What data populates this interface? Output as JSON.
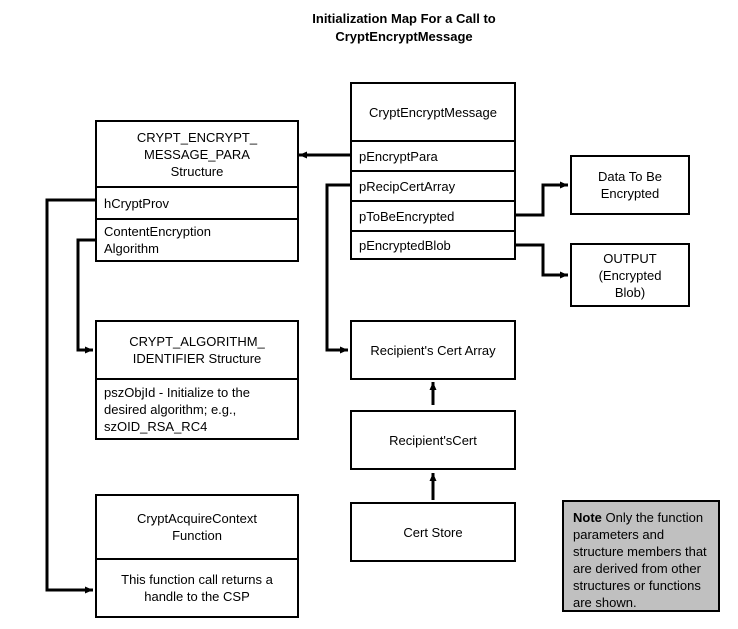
{
  "diagram": {
    "title_line1": "Initialization Map For a Call to",
    "title_line2": "CryptEncryptMessage",
    "colors": {
      "stroke": "#000000",
      "background": "#ffffff",
      "note_background": "#c0c0c0"
    }
  },
  "function_box": {
    "header": "CryptEncryptMessage",
    "params": [
      "pEncryptPara",
      "pRecipCertArray",
      "pToBeEncrypted",
      "pEncryptedBlob"
    ]
  },
  "encrypt_para_struct": {
    "header_line1": "CRYPT_ENCRYPT_",
    "header_line2": "MESSAGE_PARA",
    "header_line3": "Structure",
    "members": [
      "hCryptProv",
      "ContentEncryption\nAlgorithm"
    ],
    "member_1": "hCryptProv",
    "member_2_line1": "ContentEncryption",
    "member_2_line2": "Algorithm"
  },
  "algorithm_identifier_struct": {
    "header_line1": "CRYPT_ALGORITHM_",
    "header_line2": "IDENTIFIER Structure",
    "body_line1": "pszObjId - Initialize  to the",
    "body_line2": "desired algorithm; e.g.,",
    "body_line3": "szOID_RSA_RC4"
  },
  "acquire_context_box": {
    "header_line1": "CryptAcquireContext",
    "header_line2": "Function",
    "body_line1": "This function call returns a",
    "body_line2": "handle to the CSP"
  },
  "data_to_be_encrypted": {
    "line1": "Data To Be",
    "line2": "Encrypted"
  },
  "output_box": {
    "line1": "OUTPUT",
    "line2": "(Encrypted",
    "line3": "Blob)"
  },
  "cert_chain": {
    "recipient_cert_array": "Recipient's Cert Array",
    "recipient_cert": "Recipient'sCert",
    "cert_store": "Cert Store"
  },
  "note": {
    "label": "Note",
    "text": " Only the function parameters and structure members that are derived from other structures or functions are shown."
  }
}
